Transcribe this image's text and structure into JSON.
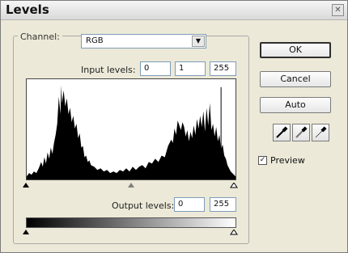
{
  "window": {
    "title": "Levels",
    "close_glyph": "✕"
  },
  "channel": {
    "label": "Channel:",
    "value": "RGB",
    "arrow_glyph": "▼"
  },
  "input_levels": {
    "label": "Input levels:",
    "shadow": "0",
    "midtone": "1",
    "highlight": "255"
  },
  "output_levels": {
    "label": "Output levels:",
    "shadow": "0",
    "highlight": "255"
  },
  "buttons": {
    "ok": "OK",
    "cancel": "Cancel",
    "auto": "Auto"
  },
  "eyedroppers": [
    {
      "name": "black-point-eyedropper-icon"
    },
    {
      "name": "gray-point-eyedropper-icon"
    },
    {
      "name": "white-point-eyedropper-icon"
    }
  ],
  "preview": {
    "label": "Preview",
    "checked": true,
    "check_glyph": "✓"
  },
  "colors": {
    "window_bg": "#ece9d8",
    "field_border": "#7f9db9",
    "histogram_fill": "#000000"
  }
}
